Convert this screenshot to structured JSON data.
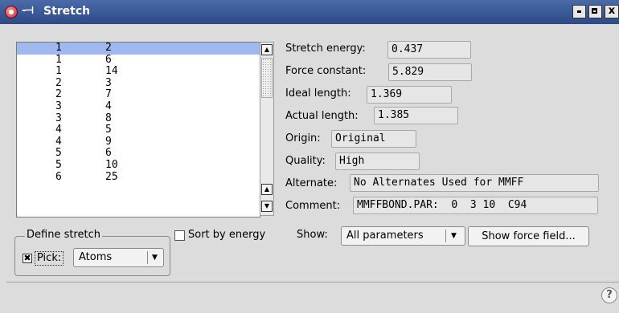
{
  "window": {
    "title": "Stretch",
    "app_icon": "app-logo-icon",
    "pin_icon": "pin-icon",
    "close_glyph": "x"
  },
  "bond_list": {
    "rows": [
      {
        "a": "1",
        "b": "2",
        "selected": true
      },
      {
        "a": "1",
        "b": "6"
      },
      {
        "a": "1",
        "b": "14"
      },
      {
        "a": "2",
        "b": "3"
      },
      {
        "a": "2",
        "b": "7"
      },
      {
        "a": "3",
        "b": "4"
      },
      {
        "a": "3",
        "b": "8"
      },
      {
        "a": "4",
        "b": "5"
      },
      {
        "a": "4",
        "b": "9"
      },
      {
        "a": "5",
        "b": "6"
      },
      {
        "a": "5",
        "b": "10"
      },
      {
        "a": "6",
        "b": "25"
      }
    ]
  },
  "params": {
    "stretch_energy": {
      "label": "Stretch energy:",
      "value": "0.437"
    },
    "force_constant": {
      "label": "Force constant:",
      "value": "5.829"
    },
    "ideal_length": {
      "label": "Ideal length:",
      "value": "1.369"
    },
    "actual_length": {
      "label": "Actual length:",
      "value": "1.385"
    },
    "origin": {
      "label": "Origin:",
      "value": "Original"
    },
    "quality": {
      "label": "Quality:",
      "value": "High"
    },
    "alternate": {
      "label": "Alternate:",
      "value": "No Alternates Used for MMFF"
    },
    "comment": {
      "label": "Comment:",
      "value": "MMFFBOND.PAR:  0  3 10  C94"
    }
  },
  "define_stretch": {
    "legend": "Define stretch",
    "pick_label": "Pick:",
    "pick_checked_glyph": "✖",
    "pick_mode": "Atoms"
  },
  "sort": {
    "label": "Sort by energy",
    "checked": false
  },
  "show": {
    "label": "Show:",
    "value": "All parameters"
  },
  "show_force_field_button": "Show force field...",
  "help_glyph": "?"
}
